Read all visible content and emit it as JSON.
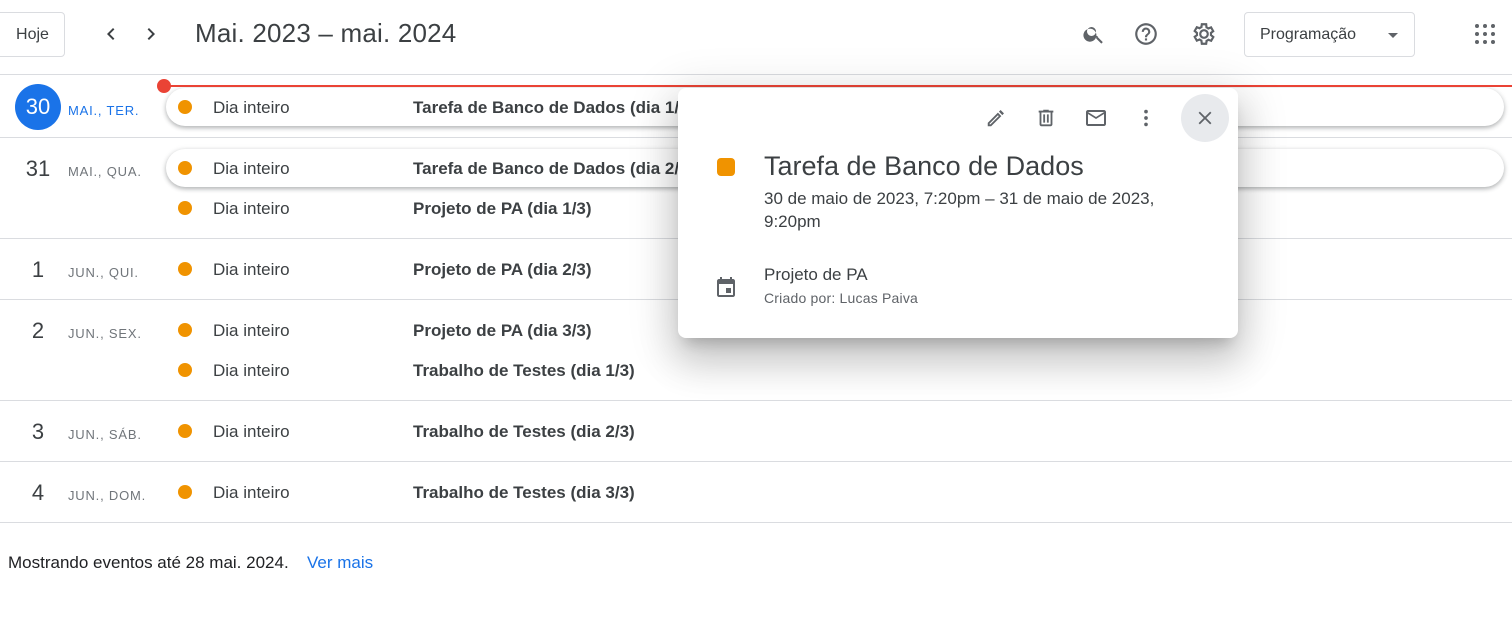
{
  "header": {
    "today_label": "Hoje",
    "title": "Mai. 2023 – mai. 2024",
    "view_label": "Programação",
    "icons": [
      "chevron-left-icon",
      "chevron-right-icon",
      "search-icon",
      "help-icon",
      "gear-icon",
      "apps-grid-icon"
    ]
  },
  "days": [
    {
      "num": "30",
      "label": "MAI., TER.",
      "today": true,
      "events": [
        {
          "time": "Dia inteiro",
          "title": "Tarefa de Banco de Dados (dia 1/2)"
        }
      ]
    },
    {
      "num": "31",
      "label": "MAI., QUA.",
      "events": [
        {
          "time": "Dia inteiro",
          "title": "Tarefa de Banco de Dados (dia 2/2)"
        },
        {
          "time": "Dia inteiro",
          "title": "Projeto de PA (dia 1/3)"
        }
      ]
    },
    {
      "num": "1",
      "label": "JUN., QUI.",
      "events": [
        {
          "time": "Dia inteiro",
          "title": "Projeto de PA (dia 2/3)"
        }
      ]
    },
    {
      "num": "2",
      "label": "JUN., SEX.",
      "events": [
        {
          "time": "Dia inteiro",
          "title": "Projeto de PA (dia 3/3)"
        },
        {
          "time": "Dia inteiro",
          "title": "Trabalho de Testes (dia 1/3)"
        }
      ]
    },
    {
      "num": "3",
      "label": "JUN., SÁB.",
      "events": [
        {
          "time": "Dia inteiro",
          "title": "Trabalho de Testes (dia 2/3)"
        }
      ]
    },
    {
      "num": "4",
      "label": "JUN., DOM.",
      "events": [
        {
          "time": "Dia inteiro",
          "title": "Trabalho de Testes (dia 3/3)"
        }
      ]
    }
  ],
  "footer": {
    "text": "Mostrando eventos até 28 mai. 2024.",
    "link": "Ver mais"
  },
  "popup": {
    "title": "Tarefa de Banco de Dados",
    "date": "30 de maio de 2023, 7:20pm – 31 de maio de 2023, 9:20pm",
    "calendar_name": "Projeto de PA",
    "creator": "Criado por: Lucas Paiva",
    "actions": [
      "edit-icon",
      "delete-icon",
      "email-icon",
      "more-vert-icon",
      "close-icon"
    ]
  },
  "colors": {
    "accent": "#1a73e8",
    "event": "#f09300",
    "now_line": "#ea4335"
  }
}
